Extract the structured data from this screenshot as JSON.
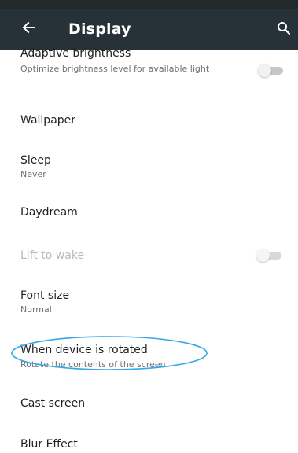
{
  "app_bar": {
    "title": "Display"
  },
  "settings": [
    {
      "title": "Adaptive brightness",
      "subtitle": "Optimize brightness level for available light",
      "toggle": "off"
    },
    {
      "title": "Wallpaper"
    },
    {
      "title": "Sleep",
      "subtitle": "Never"
    },
    {
      "title": "Daydream"
    },
    {
      "title": "Lift to wake",
      "toggle": "off",
      "state": "disabled"
    },
    {
      "title": "Font size",
      "subtitle": "Normal"
    },
    {
      "title": "When device is rotated",
      "subtitle": "Rotate the contents of the screen",
      "annotation": "circled"
    },
    {
      "title": "Cast screen"
    },
    {
      "title": "Blur Effect"
    }
  ],
  "icons": {
    "back": "arrow-back",
    "search": "magnifying-glass"
  },
  "colors": {
    "app_bar": "#263238",
    "annotation": "#35a9e8",
    "toggle_off_track": "#c7c7c7"
  }
}
